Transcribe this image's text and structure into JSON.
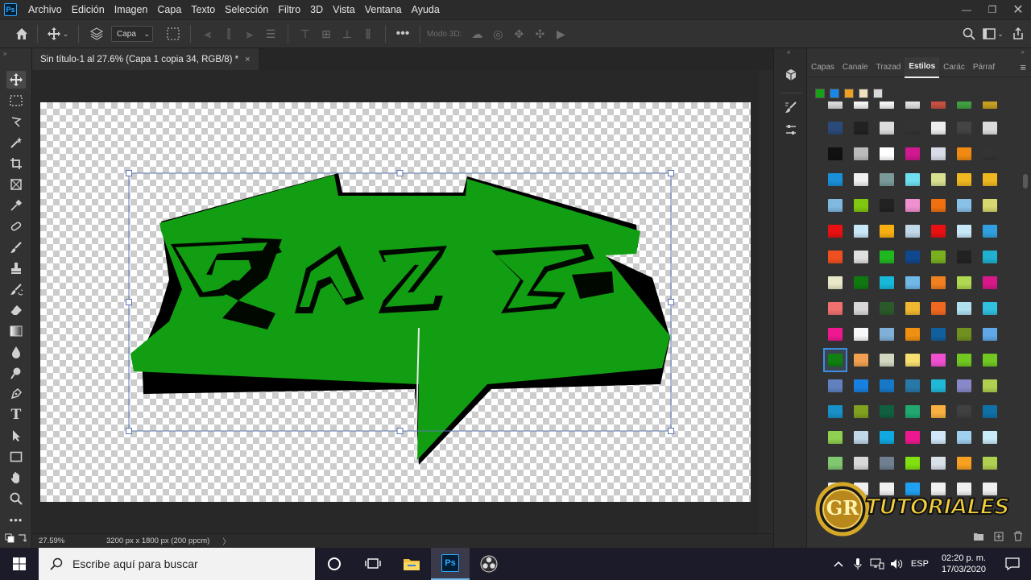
{
  "app": {
    "logo": "Ps",
    "menu": [
      "Archivo",
      "Edición",
      "Imagen",
      "Capa",
      "Texto",
      "Selección",
      "Filtro",
      "3D",
      "Vista",
      "Ventana",
      "Ayuda"
    ]
  },
  "options_bar": {
    "layer_select": "Capa",
    "mode3d_label": "Modo 3D:"
  },
  "document": {
    "tab_title": "Sin título-1 al 27.6% (Capa 1 copia 34, RGB/8) *",
    "close_glyph": "×"
  },
  "status": {
    "zoom": "27.59%",
    "doc_info": "3200 px x 1800 px (200 ppcm)",
    "arrow": "〉"
  },
  "panel": {
    "tabs": [
      "Capas",
      "Canale",
      "Trazad",
      "Estilos",
      "Carác",
      "Párraf"
    ],
    "active_tab": "Estilos"
  },
  "watermark": {
    "text": "TUTORIALES",
    "badge": "GR"
  },
  "taskbar": {
    "search_placeholder": "Escribe aquí para buscar",
    "language": "ESP",
    "time": "02:20 p. m.",
    "date": "17/03/2020"
  },
  "artwork": {
    "logo_letters": "RAZA",
    "fill_color": "#129e12",
    "shadow_color": "#000000"
  },
  "styles_swatch_colors": [
    [
      "#d8d8d8",
      "#f2f2f2",
      "#f2f2f2",
      "#e0e0e0",
      "#c85040",
      "#40a040",
      "#c8a020"
    ],
    [
      "#2a4a7a",
      "#222222",
      "#dddddd",
      "#333333",
      "#eeeeee",
      "#444444",
      "#dddddd"
    ],
    [
      "#111111",
      "#bbbbbb",
      "#ffffff",
      "#d01890",
      "#d8dce8",
      "#f08a10",
      "#333333"
    ],
    [
      "#1a90d8",
      "#f0f0f0",
      "#7a9a9a",
      "#70e0f0",
      "#d8e090",
      "#f0b820",
      "#f0b820"
    ],
    [
      "#80b8e0",
      "#80c810",
      "#222222",
      "#f090d0",
      "#f07010",
      "#88c0e8",
      "#d8d870"
    ],
    [
      "#e81010",
      "#c8e8f8",
      "#f8b010",
      "#c0d8e8",
      "#e81010",
      "#c8e8f8",
      "#30a0e0"
    ],
    [
      "#f05020",
      "#e0e0e0",
      "#20b820",
      "#104890",
      "#78b020",
      "#222222",
      "#20b0d0"
    ],
    [
      "#e8e8c8",
      "#107810",
      "#18b8d8",
      "#70b8e8",
      "#f08020",
      "#b0d850",
      "#d81888"
    ],
    [
      "#f07070",
      "#d8d8d8",
      "#2a5a2a",
      "#f0b830",
      "#f06820",
      "#b0e0f0",
      "#30c0e0"
    ],
    [
      "#f01890",
      "#f8f8f8",
      "#80b0d8",
      "#f09010",
      "#1060a0",
      "#709020",
      "#60a8e8"
    ],
    [
      "#108010",
      "#f0a050",
      "#d0d8c0",
      "#f8e070",
      "#f050d0",
      "#70c820",
      "#70c820"
    ],
    [
      "#6080c0",
      "#1880e0",
      "#1878c8",
      "#2878a8",
      "#20b8d8",
      "#8888c8",
      "#b0d050"
    ],
    [
      "#1890c8",
      "#80a020",
      "#106040",
      "#20a870",
      "#f8b040",
      "#404040",
      "#1070a8"
    ],
    [
      "#90d050",
      "#c0d8e8",
      "#10a8e0",
      "#f01890",
      "#d0e8f8",
      "#a0d0f0",
      "#c8ecf8"
    ],
    [
      "#80c870",
      "#d8d8d8",
      "#708090",
      "#80e010",
      "#d8e0e8",
      "#f8a020",
      "#b0d050"
    ],
    [
      "#f0f0f0",
      "#f0f0f0",
      "#f0f0f0",
      "#20a0f0",
      "#f0f0f0",
      "#f0f0f0",
      "#f0f0f0"
    ]
  ],
  "selected_swatch": [
    10,
    0
  ]
}
